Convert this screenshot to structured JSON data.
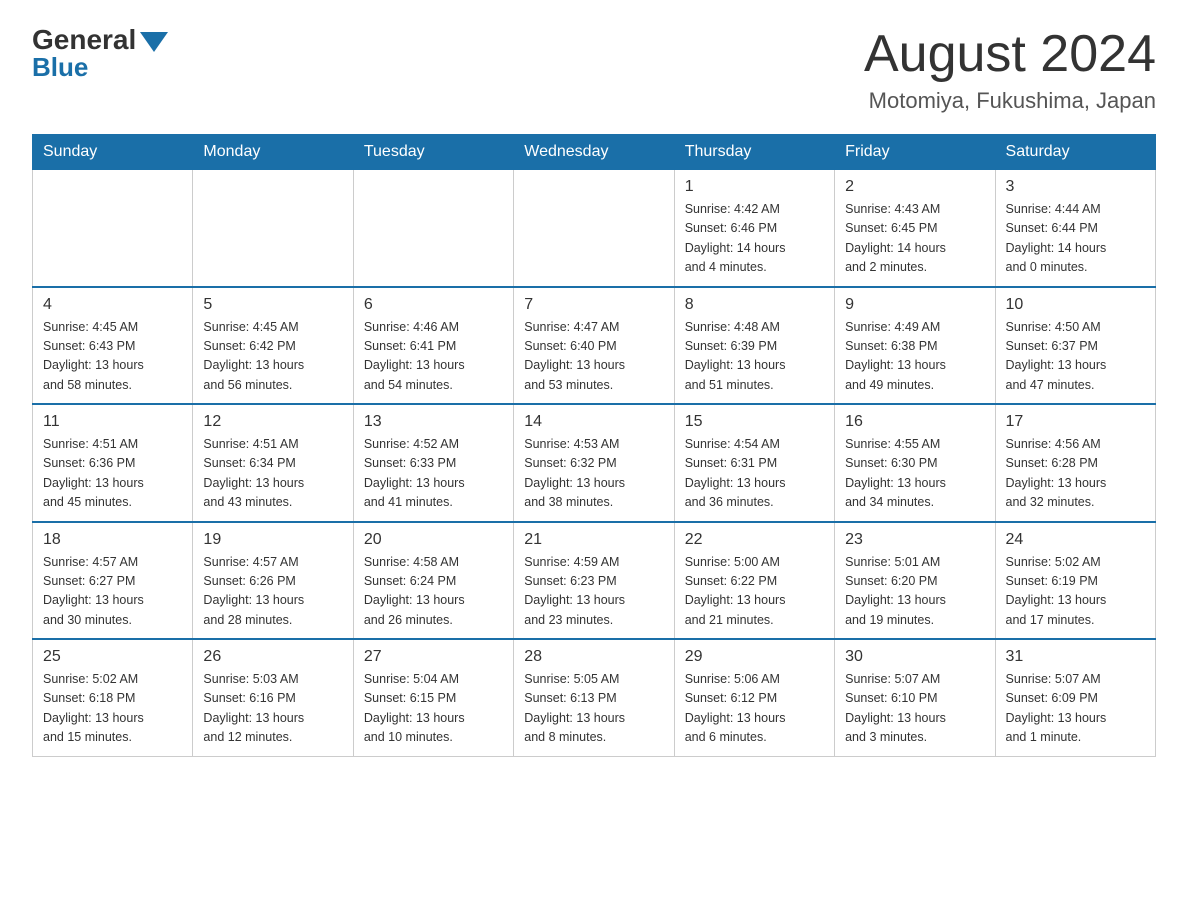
{
  "header": {
    "logo_general": "General",
    "logo_blue": "Blue",
    "month_title": "August 2024",
    "location": "Motomiya, Fukushima, Japan"
  },
  "weekdays": [
    "Sunday",
    "Monday",
    "Tuesday",
    "Wednesday",
    "Thursday",
    "Friday",
    "Saturday"
  ],
  "weeks": [
    [
      {
        "day": "",
        "info": ""
      },
      {
        "day": "",
        "info": ""
      },
      {
        "day": "",
        "info": ""
      },
      {
        "day": "",
        "info": ""
      },
      {
        "day": "1",
        "info": "Sunrise: 4:42 AM\nSunset: 6:46 PM\nDaylight: 14 hours\nand 4 minutes."
      },
      {
        "day": "2",
        "info": "Sunrise: 4:43 AM\nSunset: 6:45 PM\nDaylight: 14 hours\nand 2 minutes."
      },
      {
        "day": "3",
        "info": "Sunrise: 4:44 AM\nSunset: 6:44 PM\nDaylight: 14 hours\nand 0 minutes."
      }
    ],
    [
      {
        "day": "4",
        "info": "Sunrise: 4:45 AM\nSunset: 6:43 PM\nDaylight: 13 hours\nand 58 minutes."
      },
      {
        "day": "5",
        "info": "Sunrise: 4:45 AM\nSunset: 6:42 PM\nDaylight: 13 hours\nand 56 minutes."
      },
      {
        "day": "6",
        "info": "Sunrise: 4:46 AM\nSunset: 6:41 PM\nDaylight: 13 hours\nand 54 minutes."
      },
      {
        "day": "7",
        "info": "Sunrise: 4:47 AM\nSunset: 6:40 PM\nDaylight: 13 hours\nand 53 minutes."
      },
      {
        "day": "8",
        "info": "Sunrise: 4:48 AM\nSunset: 6:39 PM\nDaylight: 13 hours\nand 51 minutes."
      },
      {
        "day": "9",
        "info": "Sunrise: 4:49 AM\nSunset: 6:38 PM\nDaylight: 13 hours\nand 49 minutes."
      },
      {
        "day": "10",
        "info": "Sunrise: 4:50 AM\nSunset: 6:37 PM\nDaylight: 13 hours\nand 47 minutes."
      }
    ],
    [
      {
        "day": "11",
        "info": "Sunrise: 4:51 AM\nSunset: 6:36 PM\nDaylight: 13 hours\nand 45 minutes."
      },
      {
        "day": "12",
        "info": "Sunrise: 4:51 AM\nSunset: 6:34 PM\nDaylight: 13 hours\nand 43 minutes."
      },
      {
        "day": "13",
        "info": "Sunrise: 4:52 AM\nSunset: 6:33 PM\nDaylight: 13 hours\nand 41 minutes."
      },
      {
        "day": "14",
        "info": "Sunrise: 4:53 AM\nSunset: 6:32 PM\nDaylight: 13 hours\nand 38 minutes."
      },
      {
        "day": "15",
        "info": "Sunrise: 4:54 AM\nSunset: 6:31 PM\nDaylight: 13 hours\nand 36 minutes."
      },
      {
        "day": "16",
        "info": "Sunrise: 4:55 AM\nSunset: 6:30 PM\nDaylight: 13 hours\nand 34 minutes."
      },
      {
        "day": "17",
        "info": "Sunrise: 4:56 AM\nSunset: 6:28 PM\nDaylight: 13 hours\nand 32 minutes."
      }
    ],
    [
      {
        "day": "18",
        "info": "Sunrise: 4:57 AM\nSunset: 6:27 PM\nDaylight: 13 hours\nand 30 minutes."
      },
      {
        "day": "19",
        "info": "Sunrise: 4:57 AM\nSunset: 6:26 PM\nDaylight: 13 hours\nand 28 minutes."
      },
      {
        "day": "20",
        "info": "Sunrise: 4:58 AM\nSunset: 6:24 PM\nDaylight: 13 hours\nand 26 minutes."
      },
      {
        "day": "21",
        "info": "Sunrise: 4:59 AM\nSunset: 6:23 PM\nDaylight: 13 hours\nand 23 minutes."
      },
      {
        "day": "22",
        "info": "Sunrise: 5:00 AM\nSunset: 6:22 PM\nDaylight: 13 hours\nand 21 minutes."
      },
      {
        "day": "23",
        "info": "Sunrise: 5:01 AM\nSunset: 6:20 PM\nDaylight: 13 hours\nand 19 minutes."
      },
      {
        "day": "24",
        "info": "Sunrise: 5:02 AM\nSunset: 6:19 PM\nDaylight: 13 hours\nand 17 minutes."
      }
    ],
    [
      {
        "day": "25",
        "info": "Sunrise: 5:02 AM\nSunset: 6:18 PM\nDaylight: 13 hours\nand 15 minutes."
      },
      {
        "day": "26",
        "info": "Sunrise: 5:03 AM\nSunset: 6:16 PM\nDaylight: 13 hours\nand 12 minutes."
      },
      {
        "day": "27",
        "info": "Sunrise: 5:04 AM\nSunset: 6:15 PM\nDaylight: 13 hours\nand 10 minutes."
      },
      {
        "day": "28",
        "info": "Sunrise: 5:05 AM\nSunset: 6:13 PM\nDaylight: 13 hours\nand 8 minutes."
      },
      {
        "day": "29",
        "info": "Sunrise: 5:06 AM\nSunset: 6:12 PM\nDaylight: 13 hours\nand 6 minutes."
      },
      {
        "day": "30",
        "info": "Sunrise: 5:07 AM\nSunset: 6:10 PM\nDaylight: 13 hours\nand 3 minutes."
      },
      {
        "day": "31",
        "info": "Sunrise: 5:07 AM\nSunset: 6:09 PM\nDaylight: 13 hours\nand 1 minute."
      }
    ]
  ]
}
